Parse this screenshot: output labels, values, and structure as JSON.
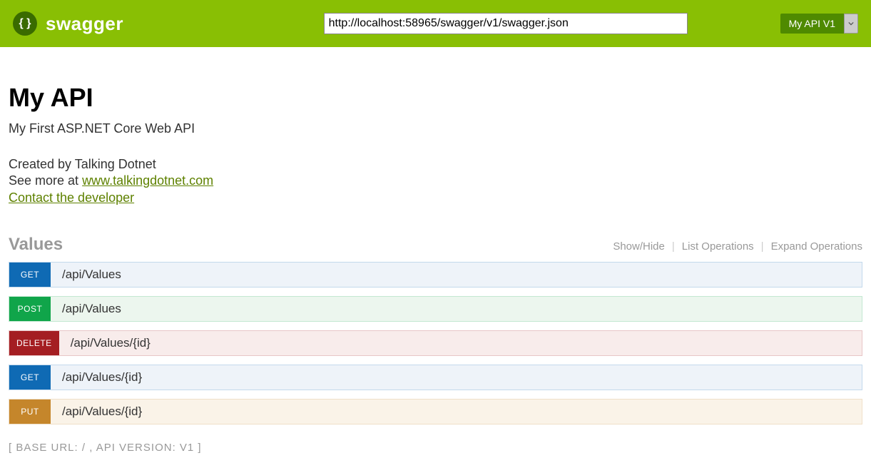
{
  "header": {
    "brand": "swagger",
    "url_value": "http://localhost:58965/swagger/v1/swagger.json",
    "selector_label": "My API V1"
  },
  "api": {
    "title": "My API",
    "description": "My First ASP.NET Core Web API",
    "created_by_prefix": "Created by ",
    "created_by": "Talking Dotnet",
    "see_more_prefix": "See more at ",
    "see_more_link": "www.talkingdotnet.com",
    "contact_link": "Contact the developer"
  },
  "section": {
    "title": "Values",
    "actions": {
      "show_hide": "Show/Hide",
      "list_ops": "List Operations",
      "expand_ops": "Expand Operations"
    }
  },
  "operations": [
    {
      "method": "GET",
      "path": "/api/Values",
      "cls": "op-get"
    },
    {
      "method": "POST",
      "path": "/api/Values",
      "cls": "op-post"
    },
    {
      "method": "DELETE",
      "path": "/api/Values/{id}",
      "cls": "op-delete"
    },
    {
      "method": "GET",
      "path": "/api/Values/{id}",
      "cls": "op-get"
    },
    {
      "method": "PUT",
      "path": "/api/Values/{id}",
      "cls": "op-put"
    }
  ],
  "footer": {
    "base_url_label": "[ BASE URL: / , API VERSION: V1 ]"
  }
}
